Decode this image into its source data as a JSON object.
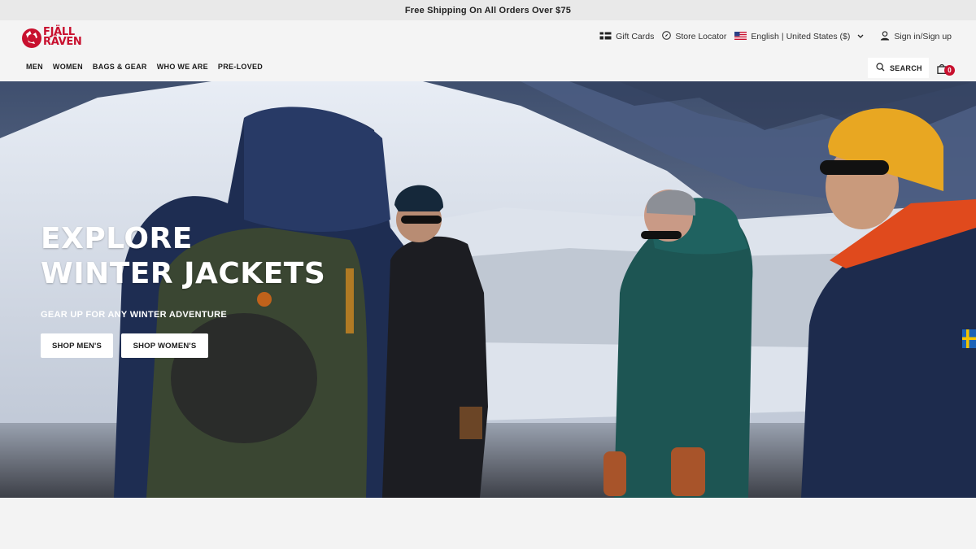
{
  "promo": {
    "text": "Free Shipping On All Orders Over $75"
  },
  "brand": {
    "line1": "FJÄLL",
    "line2": "RÄVEN",
    "color": "#c8102e"
  },
  "utility": {
    "gift_cards": "Gift Cards",
    "store_locator": "Store Locator",
    "language": "English",
    "separator": "|",
    "region": "United States ($)",
    "sign_in": "Sign in/Sign up"
  },
  "nav": {
    "items": [
      {
        "label": "MEN"
      },
      {
        "label": "WOMEN"
      },
      {
        "label": "BAGS & GEAR"
      },
      {
        "label": "WHO WE ARE"
      },
      {
        "label": "PRE-LOVED"
      }
    ]
  },
  "search": {
    "label": "SEARCH"
  },
  "cart": {
    "count": "0"
  },
  "hero": {
    "title_line1": "EXPLORE",
    "title_line2": "WINTER JACKETS",
    "subtitle": "GEAR UP FOR ANY WINTER ADVENTURE",
    "cta_men": "SHOP MEN'S",
    "cta_women": "SHOP WOMEN'S"
  },
  "icons": {
    "gift": "gift-card-icon",
    "store": "compass-icon",
    "flag": "us-flag-icon",
    "chevron": "chevron-down-icon",
    "user": "user-icon",
    "search": "search-icon",
    "cart": "shopping-bag-icon",
    "sweden": "sweden-flag-icon"
  },
  "colors": {
    "accent": "#c8102e",
    "promo_bg": "#e9e9e9",
    "header_bg": "#f4f4f4"
  }
}
